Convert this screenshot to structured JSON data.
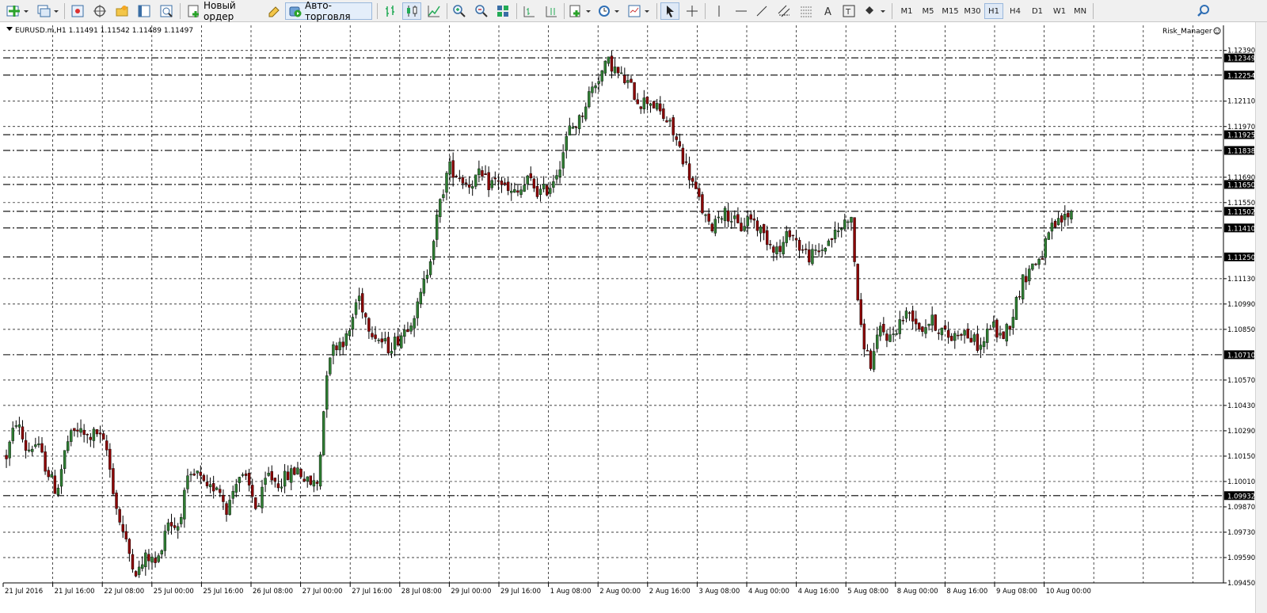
{
  "toolbar": {
    "new_order_label": "Новый ордер",
    "autotrading_label": "Авто-торговля",
    "timeframes": [
      "M1",
      "M5",
      "M15",
      "M30",
      "H1",
      "H4",
      "D1",
      "W1",
      "MN"
    ],
    "active_timeframe": "H1"
  },
  "chart_header": {
    "symbol_info": "EURUSD.m,H1  1.11491 1.11542 1.11489 1.11497",
    "indicator": "Risk_Manager"
  },
  "price_axis_labels": [
    "1.12390",
    "1.12110",
    "1.11970",
    "1.11690",
    "1.11550",
    "1.11130",
    "1.10990",
    "1.10850",
    "1.10570",
    "1.10430",
    "1.10290",
    "1.10150",
    "1.10010",
    "1.09870",
    "1.09730",
    "1.09590",
    "1.09450"
  ],
  "level_lines": [
    "1.12349",
    "1.12254",
    "1.11925",
    "1.11838",
    "1.11650",
    "1.11502",
    "1.11410",
    "1.11250",
    "1.10710",
    "1.09932"
  ],
  "time_axis_labels": [
    "21 Jul 2016",
    "21 Jul 16:00",
    "22 Jul 08:00",
    "25 Jul 00:00",
    "25 Jul 16:00",
    "26 Jul 08:00",
    "27 Jul 00:00",
    "27 Jul 16:00",
    "28 Jul 08:00",
    "29 Jul 00:00",
    "29 Jul 16:00",
    "1 Aug 08:00",
    "2 Aug 00:00",
    "2 Aug 16:00",
    "3 Aug 08:00",
    "4 Aug 00:00",
    "4 Aug 16:00",
    "5 Aug 08:00",
    "8 Aug 00:00",
    "8 Aug 16:00",
    "9 Aug 08:00",
    "10 Aug 00:00"
  ],
  "colors": {
    "bull_candle": "#2e7d32",
    "bear_candle": "#8b0000",
    "grid": "#000000",
    "background": "#ffffff"
  },
  "chart_data": {
    "type": "candlestick",
    "symbol": "EURUSD.m",
    "timeframe": "H1",
    "ylim": [
      1.0945,
      1.1245
    ],
    "last_price": 1.11497,
    "path": [
      1.1015,
      1.1035,
      1.1018,
      1.1022,
      1.1008,
      1.0995,
      1.1022,
      1.103,
      1.1025,
      1.1028,
      1.1018,
      1.0985,
      1.0965,
      1.095,
      1.096,
      1.0955,
      1.098,
      1.0975,
      1.1,
      1.1005,
      1.0995,
      1.1,
      1.0985,
      1.1005,
      1.1,
      1.0985,
      1.1005,
      1.1,
      1.1004,
      1.1008,
      1.1,
      1.1,
      1.107,
      1.1078,
      1.108,
      1.1105,
      1.1088,
      1.108,
      1.1075,
      1.108,
      1.1088,
      1.1098,
      1.112,
      1.115,
      1.1175,
      1.117,
      1.1165,
      1.117,
      1.1165,
      1.1168,
      1.116,
      1.116,
      1.1168,
      1.116,
      1.1163,
      1.1175,
      1.1195,
      1.12,
      1.1215,
      1.1225,
      1.1233,
      1.1225,
      1.122,
      1.121,
      1.1212,
      1.1205,
      1.1198,
      1.1185,
      1.117,
      1.1155,
      1.114,
      1.115,
      1.1148,
      1.114,
      1.1148,
      1.114,
      1.1133,
      1.1128,
      1.114,
      1.113,
      1.1125,
      1.1128,
      1.1135,
      1.114,
      1.115,
      1.1085,
      1.1065,
      1.1085,
      1.108,
      1.109,
      1.1095,
      1.1085,
      1.109,
      1.1085,
      1.108,
      1.1085,
      1.108,
      1.1075,
      1.1088,
      1.108,
      1.109,
      1.111,
      1.112,
      1.1125,
      1.114,
      1.1145,
      1.115
    ]
  }
}
